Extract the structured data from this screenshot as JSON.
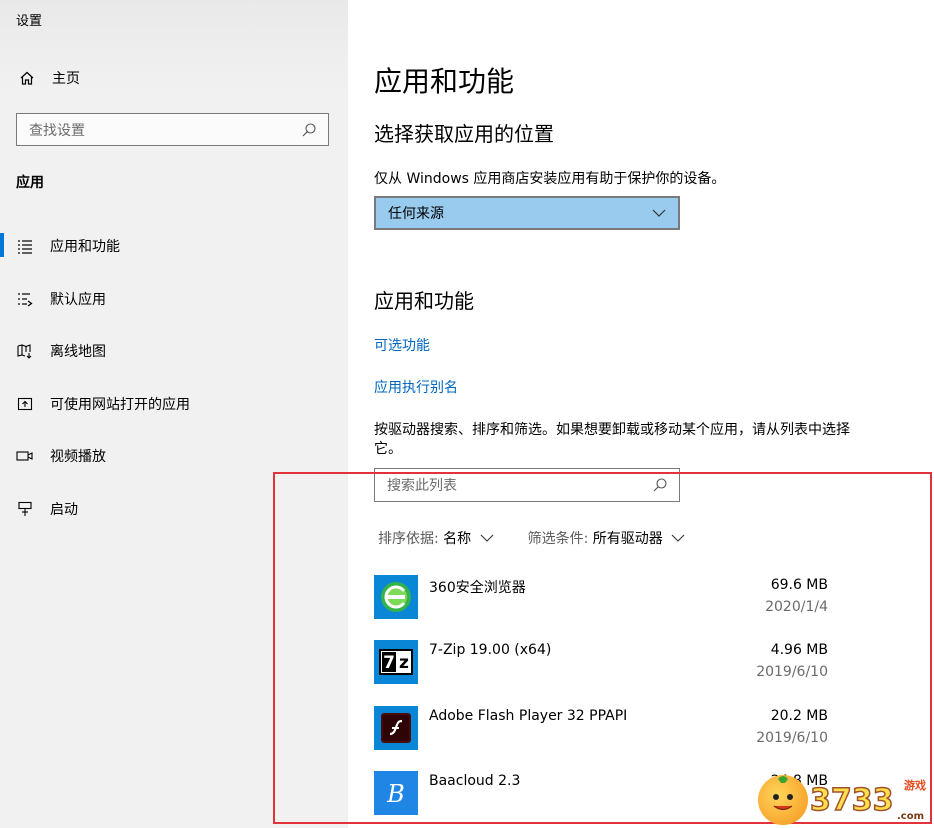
{
  "window": {
    "title": "设置"
  },
  "sidebar": {
    "home_label": "主页",
    "search_placeholder": "查找设置",
    "section_label": "应用",
    "items": [
      {
        "label": "应用和功能",
        "icon": "apps-features-icon",
        "active": true
      },
      {
        "label": "默认应用",
        "icon": "default-apps-icon"
      },
      {
        "label": "离线地图",
        "icon": "offline-maps-icon"
      },
      {
        "label": "可使用网站打开的应用",
        "icon": "apps-for-websites-icon"
      },
      {
        "label": "视频播放",
        "icon": "video-playback-icon"
      },
      {
        "label": "启动",
        "icon": "startup-icon"
      }
    ]
  },
  "main": {
    "title": "应用和功能",
    "install_heading": "选择获取应用的位置",
    "install_desc": "仅从 Windows 应用商店安装应用有助于保护你的设备。",
    "install_source_value": "任何来源",
    "apps_heading": "应用和功能",
    "optional_features_link": "可选功能",
    "app_alias_link": "应用执行别名",
    "search_desc": "按驱动器搜索、排序和筛选。如果想要卸载或移动某个应用，请从列表中选择它。",
    "list_search_placeholder": "搜索此列表",
    "sort_label": "排序依据:",
    "sort_value": "名称",
    "filter_label": "筛选条件:",
    "filter_value": "所有驱动器",
    "apps": [
      {
        "name": "360安全浏览器",
        "size": "69.6 MB",
        "date": "2020/1/4",
        "icon": "360-browser-icon"
      },
      {
        "name": "7-Zip 19.00 (x64)",
        "size": "4.96 MB",
        "date": "2019/6/10",
        "icon": "7zip-icon"
      },
      {
        "name": "Adobe Flash Player 32 PPAPI",
        "size": "20.2 MB",
        "date": "2019/6/10",
        "icon": "flash-player-icon"
      },
      {
        "name": "Baacloud 2.3",
        "size": "24.8 MB",
        "date": "",
        "icon": "baacloud-icon"
      }
    ]
  },
  "watermark": {
    "text": "3733",
    "sub": "游戏",
    "domain": ".com"
  },
  "colors": {
    "accent": "#0078d7",
    "link": "#0067c0",
    "dropdown_bg": "#99cbef",
    "highlight": "#e2333a"
  }
}
